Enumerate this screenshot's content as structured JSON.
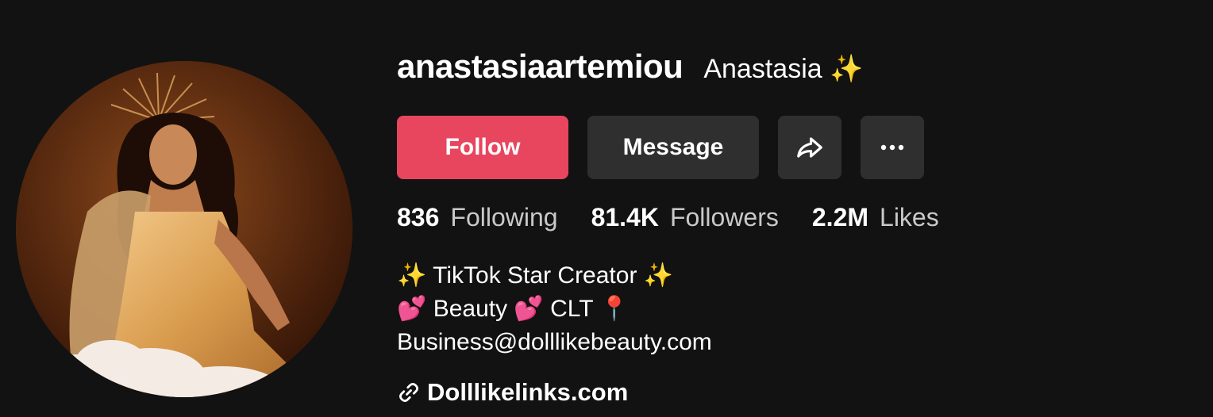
{
  "profile": {
    "username": "anastasiaartemiou",
    "nickname": "Anastasia",
    "nickname_emoji": "✨"
  },
  "actions": {
    "follow_label": "Follow",
    "message_label": "Message",
    "share_icon": "share-arrow-icon",
    "more_icon": "more-dots-icon"
  },
  "stats": [
    {
      "value": "836",
      "label": "Following"
    },
    {
      "value": "81.4K",
      "label": "Followers"
    },
    {
      "value": "2.2M",
      "label": "Likes"
    }
  ],
  "bio": {
    "line1": "✨ TikTok Star Creator ✨",
    "line2": "💕 Beauty 💕 CLT 📍",
    "line3": "Business@dolllikebeauty.com"
  },
  "link": {
    "icon": "link-icon",
    "text": "Dolllikelinks.com"
  },
  "colors": {
    "background": "#121212",
    "follow_button": "#e8465e",
    "secondary_button": "#2f2f2f"
  }
}
